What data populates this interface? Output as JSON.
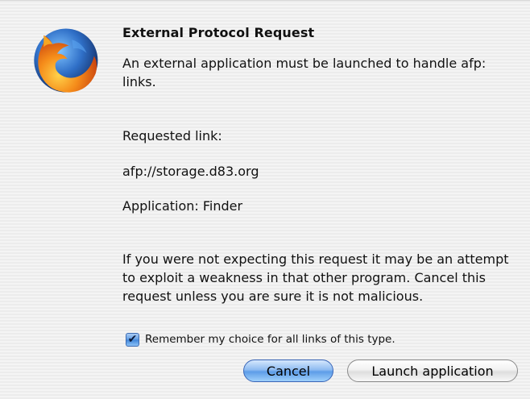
{
  "dialog": {
    "title": "External Protocol Request",
    "message": "An external application must be launched to handle afp: links.",
    "requested_link_label": "Requested link:",
    "requested_link": "afp://storage.d83.org",
    "application": "Application: Finder",
    "warning": "If you were not expecting this request it may be an attempt to exploit a weakness in that other program. Cancel this request unless you are sure it is not malicious.",
    "remember_label": "Remember my choice for all links of this type.",
    "remember_checked": true,
    "cancel_label": "Cancel",
    "launch_label": "Launch application",
    "logo_icon": "firefox-logo-icon",
    "checkmark_icon": "checkmark-icon",
    "accent_color": "#5e9be3"
  }
}
